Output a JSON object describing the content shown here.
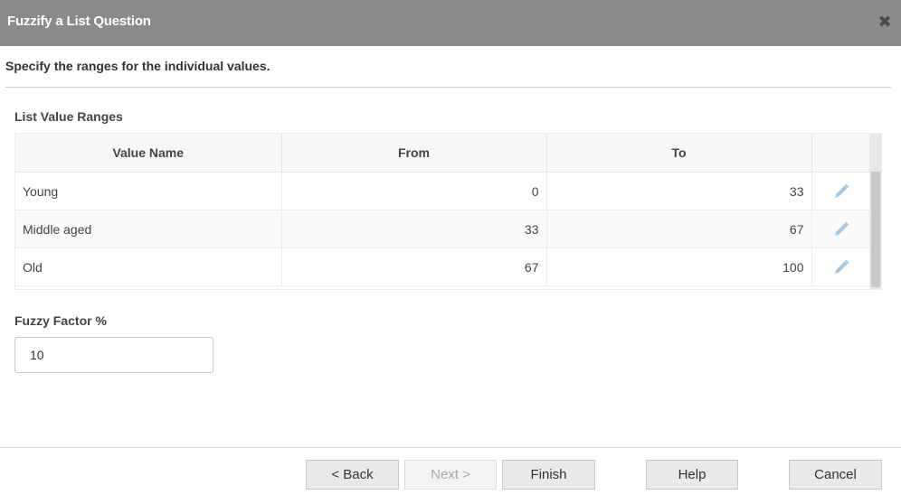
{
  "dialog": {
    "title": "Fuzzify a List Question",
    "close_icon": "close-icon",
    "instruction": "Specify the ranges for the individual values."
  },
  "ranges": {
    "label": "List Value Ranges",
    "columns": [
      "Value Name",
      "From",
      "To"
    ],
    "rows": [
      {
        "name": "Young",
        "from": "0",
        "to": "33"
      },
      {
        "name": "Middle aged",
        "from": "33",
        "to": "67"
      },
      {
        "name": "Old",
        "from": "67",
        "to": "100"
      }
    ],
    "row_action_icon": "pencil-icon"
  },
  "fuzzy": {
    "label": "Fuzzy Factor %",
    "value": "10"
  },
  "footer": {
    "back": "< Back",
    "next": "Next >",
    "finish": "Finish",
    "help": "Help",
    "cancel": "Cancel"
  },
  "colors": {
    "titlebar": "#8a8a8a",
    "button_bg": "#e9e9e9",
    "pencil": "#a8c8de"
  }
}
